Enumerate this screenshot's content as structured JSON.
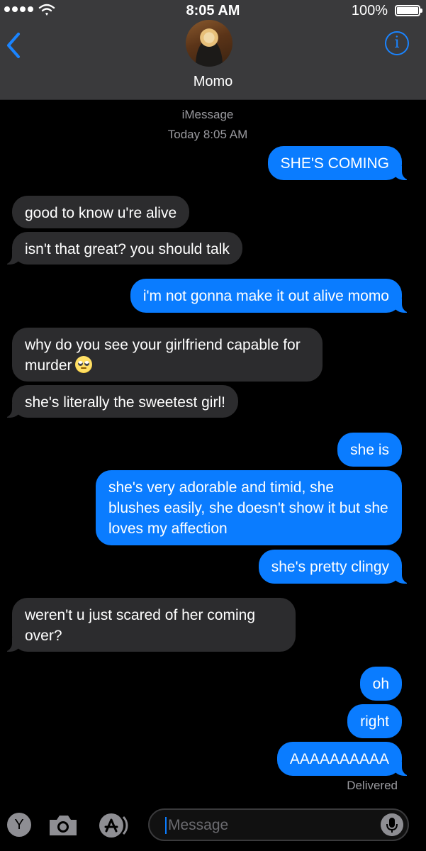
{
  "status_bar": {
    "time": "8:05 AM",
    "battery": "100%"
  },
  "header": {
    "contact_name": "Momo",
    "info_icon": "i"
  },
  "thread": {
    "service": "iMessage",
    "timestamp": "Today 8:05 AM",
    "messages": [
      {
        "from": "me",
        "text": "SHE'S COMING"
      },
      {
        "from": "them",
        "text": "good to know u're alive"
      },
      {
        "from": "them",
        "text": "isn't that great? you should talk"
      },
      {
        "from": "me",
        "text": "i'm not gonna make it out alive momo"
      },
      {
        "from": "them",
        "text": "why do you see your girlfriend capable for murder",
        "emoji": "face-with-rolling-eyes"
      },
      {
        "from": "them",
        "text": "she's literally the sweetest girl!"
      },
      {
        "from": "me",
        "text": "she is"
      },
      {
        "from": "me",
        "text": "she's very adorable and timid, she blushes easily, she doesn't show it but she loves my affection"
      },
      {
        "from": "me",
        "text": "she's pretty clingy"
      },
      {
        "from": "them",
        "text": "weren't u just scared of her coming over?"
      },
      {
        "from": "me",
        "text": "oh"
      },
      {
        "from": "me",
        "text": "right"
      },
      {
        "from": "me",
        "text": "AAAAAAAAAA"
      }
    ],
    "delivered_label": "Delivered"
  },
  "input_bar": {
    "app_letter": "Y",
    "placeholder": "Message"
  },
  "colors": {
    "outgoing_bubble": "#0a7cff",
    "incoming_bubble": "#2c2c2e",
    "header_bg": "#3a3a3c",
    "accent": "#1a84ff"
  },
  "icons": [
    "signal-dots-icon",
    "wifi-icon",
    "battery-icon",
    "back-chevron-icon",
    "info-icon",
    "camera-icon",
    "app-store-icon",
    "microphone-icon"
  ]
}
